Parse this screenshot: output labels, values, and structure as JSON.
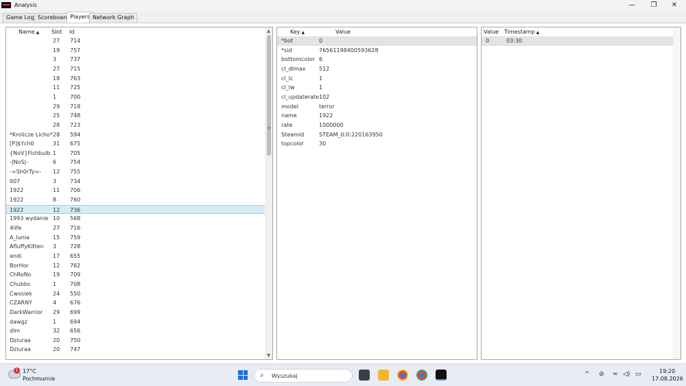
{
  "window": {
    "title": "Analysis",
    "minimize_glyph": "—",
    "maximize_glyph": "❐",
    "close_glyph": "✕"
  },
  "tabs": [
    "Game Log",
    "Scoreboard",
    "Players",
    "Network Graph"
  ],
  "active_tab": "Players",
  "players_table": {
    "columns": [
      "Name",
      "Slot",
      "Id"
    ],
    "sort_column": "Name",
    "sort_glyph": "▲",
    "selected_index": 18,
    "rows": [
      {
        "name": "",
        "slot": "27",
        "id": "714"
      },
      {
        "name": "",
        "slot": "19",
        "id": "757"
      },
      {
        "name": "",
        "slot": "3",
        "id": "737"
      },
      {
        "name": "",
        "slot": "27",
        "id": "715"
      },
      {
        "name": "",
        "slot": "18",
        "id": "763"
      },
      {
        "name": "",
        "slot": "11",
        "id": "725"
      },
      {
        "name": "",
        "slot": "1",
        "id": "700"
      },
      {
        "name": "",
        "slot": "29",
        "id": "718"
      },
      {
        "name": "",
        "slot": "25",
        "id": "748"
      },
      {
        "name": "",
        "slot": "28",
        "id": "723"
      },
      {
        "name": "*Krolicze Licho*",
        "slot": "28",
        "id": "594"
      },
      {
        "name": "[P]$Ych0",
        "slot": "31",
        "id": "675"
      },
      {
        "name": "{NoV}Fishbulb",
        "slot": "1",
        "id": "705"
      },
      {
        "name": "-|NoS|-",
        "slot": "6",
        "id": "754"
      },
      {
        "name": "-=Sh0rTy=-",
        "slot": "12",
        "id": "755"
      },
      {
        "name": "007",
        "slot": "3",
        "id": "734"
      },
      {
        "name": "1922",
        "slot": "11",
        "id": "706"
      },
      {
        "name": "1922",
        "slot": "8",
        "id": "760"
      },
      {
        "name": "1922",
        "slot": "12",
        "id": "736"
      },
      {
        "name": "1993 wydanie",
        "slot": "10",
        "id": "568"
      },
      {
        "name": "4life",
        "slot": "27",
        "id": "716"
      },
      {
        "name": "A_lunia",
        "slot": "15",
        "id": "759"
      },
      {
        "name": "AfluffyKitten",
        "slot": "3",
        "id": "728"
      },
      {
        "name": "andi",
        "slot": "17",
        "id": "655"
      },
      {
        "name": "BorHor",
        "slot": "12",
        "id": "762"
      },
      {
        "name": "ChRoNo",
        "slot": "19",
        "id": "709"
      },
      {
        "name": "Chubbs",
        "slot": "1",
        "id": "708"
      },
      {
        "name": "Cwosiek",
        "slot": "24",
        "id": "550"
      },
      {
        "name": "CZARNY",
        "slot": "4",
        "id": "676"
      },
      {
        "name": "DarkWarrior",
        "slot": "29",
        "id": "699"
      },
      {
        "name": "dawgz",
        "slot": "1",
        "id": "694"
      },
      {
        "name": "dlm",
        "slot": "32",
        "id": "656"
      },
      {
        "name": "Dziuraa",
        "slot": "20",
        "id": "750"
      },
      {
        "name": "Dziuraa",
        "slot": "20",
        "id": "747"
      }
    ]
  },
  "scroll": {
    "up_glyph": "▲",
    "down_glyph": "▼",
    "splitter_glyph": "≡",
    "position_fraction": 0.0,
    "visible_fraction": 0.38
  },
  "keyvalue_table": {
    "columns": [
      "Key",
      "Value"
    ],
    "sort_column": "Key",
    "sort_glyph": "▲",
    "selected_index": 0,
    "rows": [
      {
        "key": "*bot",
        "value": "0"
      },
      {
        "key": "*sid",
        "value": "76561198400593628"
      },
      {
        "key": "bottomcolor",
        "value": "6"
      },
      {
        "key": "cl_dlmax",
        "value": "512"
      },
      {
        "key": "cl_lc",
        "value": "1"
      },
      {
        "key": "cl_lw",
        "value": "1"
      },
      {
        "key": "cl_updaterate",
        "value": "102"
      },
      {
        "key": "model",
        "value": "terror"
      },
      {
        "key": "name",
        "value": "1922"
      },
      {
        "key": "rate",
        "value": "1000000"
      },
      {
        "key": "SteamId",
        "value": "STEAM_0:0:220163950"
      },
      {
        "key": "topcolor",
        "value": "30"
      }
    ]
  },
  "history_table": {
    "columns": [
      "Value",
      "Timestamp"
    ],
    "sort_column": "Timestamp",
    "sort_glyph": "▲",
    "selected_index": 0,
    "rows": [
      {
        "value": "0",
        "timestamp": "03:30"
      }
    ]
  },
  "taskbar": {
    "weather_temp": "17°C",
    "weather_desc": "Pochmurnie",
    "weather_badge": "1",
    "search_placeholder": "Wyszukaj",
    "search_glyph": "⌕",
    "tray_chevron": "^",
    "time": "19:20",
    "date": "17.08.2026"
  }
}
